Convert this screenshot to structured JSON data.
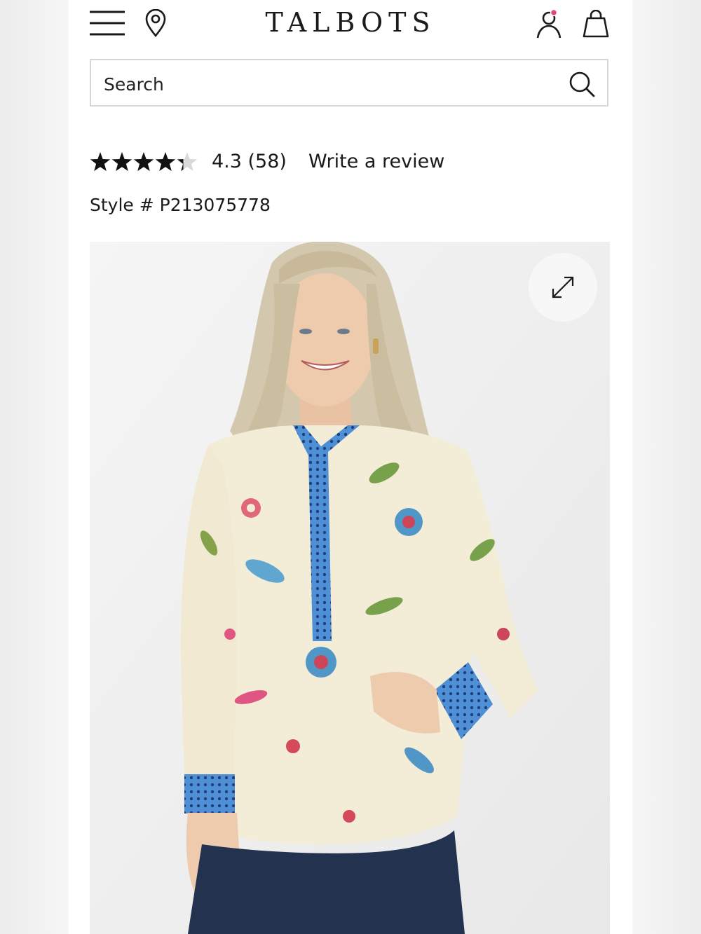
{
  "header": {
    "brand": "TALBOTS",
    "menu_icon": "hamburger-menu-icon",
    "location_icon": "map-pin-icon",
    "account_icon": "user-account-icon",
    "bag_icon": "shopping-bag-icon",
    "account_dot_color": "#e0457b"
  },
  "search": {
    "placeholder": "Search",
    "icon": "search-icon"
  },
  "rating": {
    "stars_value": 4.3,
    "stars_max": 5,
    "text": "4.3 (58)",
    "review_link": "Write a review"
  },
  "product": {
    "style_number": "Style # P213075778",
    "zoom_icon": "expand-icon",
    "colors": {
      "blouse": "#f3ecd6",
      "trim": "#4f8fd6",
      "jeans": "#22324f"
    }
  }
}
